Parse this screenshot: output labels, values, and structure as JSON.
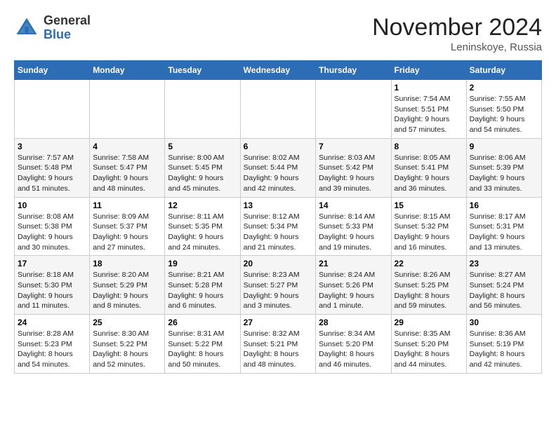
{
  "logo": {
    "general": "General",
    "blue": "Blue"
  },
  "header": {
    "month": "November 2024",
    "location": "Leninskoye, Russia"
  },
  "weekdays": [
    "Sunday",
    "Monday",
    "Tuesday",
    "Wednesday",
    "Thursday",
    "Friday",
    "Saturday"
  ],
  "weeks": [
    [
      {
        "day": "",
        "info": ""
      },
      {
        "day": "",
        "info": ""
      },
      {
        "day": "",
        "info": ""
      },
      {
        "day": "",
        "info": ""
      },
      {
        "day": "",
        "info": ""
      },
      {
        "day": "1",
        "info": "Sunrise: 7:54 AM\nSunset: 5:51 PM\nDaylight: 9 hours and 57 minutes."
      },
      {
        "day": "2",
        "info": "Sunrise: 7:55 AM\nSunset: 5:50 PM\nDaylight: 9 hours and 54 minutes."
      }
    ],
    [
      {
        "day": "3",
        "info": "Sunrise: 7:57 AM\nSunset: 5:48 PM\nDaylight: 9 hours and 51 minutes."
      },
      {
        "day": "4",
        "info": "Sunrise: 7:58 AM\nSunset: 5:47 PM\nDaylight: 9 hours and 48 minutes."
      },
      {
        "day": "5",
        "info": "Sunrise: 8:00 AM\nSunset: 5:45 PM\nDaylight: 9 hours and 45 minutes."
      },
      {
        "day": "6",
        "info": "Sunrise: 8:02 AM\nSunset: 5:44 PM\nDaylight: 9 hours and 42 minutes."
      },
      {
        "day": "7",
        "info": "Sunrise: 8:03 AM\nSunset: 5:42 PM\nDaylight: 9 hours and 39 minutes."
      },
      {
        "day": "8",
        "info": "Sunrise: 8:05 AM\nSunset: 5:41 PM\nDaylight: 9 hours and 36 minutes."
      },
      {
        "day": "9",
        "info": "Sunrise: 8:06 AM\nSunset: 5:39 PM\nDaylight: 9 hours and 33 minutes."
      }
    ],
    [
      {
        "day": "10",
        "info": "Sunrise: 8:08 AM\nSunset: 5:38 PM\nDaylight: 9 hours and 30 minutes."
      },
      {
        "day": "11",
        "info": "Sunrise: 8:09 AM\nSunset: 5:37 PM\nDaylight: 9 hours and 27 minutes."
      },
      {
        "day": "12",
        "info": "Sunrise: 8:11 AM\nSunset: 5:35 PM\nDaylight: 9 hours and 24 minutes."
      },
      {
        "day": "13",
        "info": "Sunrise: 8:12 AM\nSunset: 5:34 PM\nDaylight: 9 hours and 21 minutes."
      },
      {
        "day": "14",
        "info": "Sunrise: 8:14 AM\nSunset: 5:33 PM\nDaylight: 9 hours and 19 minutes."
      },
      {
        "day": "15",
        "info": "Sunrise: 8:15 AM\nSunset: 5:32 PM\nDaylight: 9 hours and 16 minutes."
      },
      {
        "day": "16",
        "info": "Sunrise: 8:17 AM\nSunset: 5:31 PM\nDaylight: 9 hours and 13 minutes."
      }
    ],
    [
      {
        "day": "17",
        "info": "Sunrise: 8:18 AM\nSunset: 5:30 PM\nDaylight: 9 hours and 11 minutes."
      },
      {
        "day": "18",
        "info": "Sunrise: 8:20 AM\nSunset: 5:29 PM\nDaylight: 9 hours and 8 minutes."
      },
      {
        "day": "19",
        "info": "Sunrise: 8:21 AM\nSunset: 5:28 PM\nDaylight: 9 hours and 6 minutes."
      },
      {
        "day": "20",
        "info": "Sunrise: 8:23 AM\nSunset: 5:27 PM\nDaylight: 9 hours and 3 minutes."
      },
      {
        "day": "21",
        "info": "Sunrise: 8:24 AM\nSunset: 5:26 PM\nDaylight: 9 hours and 1 minute."
      },
      {
        "day": "22",
        "info": "Sunrise: 8:26 AM\nSunset: 5:25 PM\nDaylight: 8 hours and 59 minutes."
      },
      {
        "day": "23",
        "info": "Sunrise: 8:27 AM\nSunset: 5:24 PM\nDaylight: 8 hours and 56 minutes."
      }
    ],
    [
      {
        "day": "24",
        "info": "Sunrise: 8:28 AM\nSunset: 5:23 PM\nDaylight: 8 hours and 54 minutes."
      },
      {
        "day": "25",
        "info": "Sunrise: 8:30 AM\nSunset: 5:22 PM\nDaylight: 8 hours and 52 minutes."
      },
      {
        "day": "26",
        "info": "Sunrise: 8:31 AM\nSunset: 5:22 PM\nDaylight: 8 hours and 50 minutes."
      },
      {
        "day": "27",
        "info": "Sunrise: 8:32 AM\nSunset: 5:21 PM\nDaylight: 8 hours and 48 minutes."
      },
      {
        "day": "28",
        "info": "Sunrise: 8:34 AM\nSunset: 5:20 PM\nDaylight: 8 hours and 46 minutes."
      },
      {
        "day": "29",
        "info": "Sunrise: 8:35 AM\nSunset: 5:20 PM\nDaylight: 8 hours and 44 minutes."
      },
      {
        "day": "30",
        "info": "Sunrise: 8:36 AM\nSunset: 5:19 PM\nDaylight: 8 hours and 42 minutes."
      }
    ]
  ]
}
